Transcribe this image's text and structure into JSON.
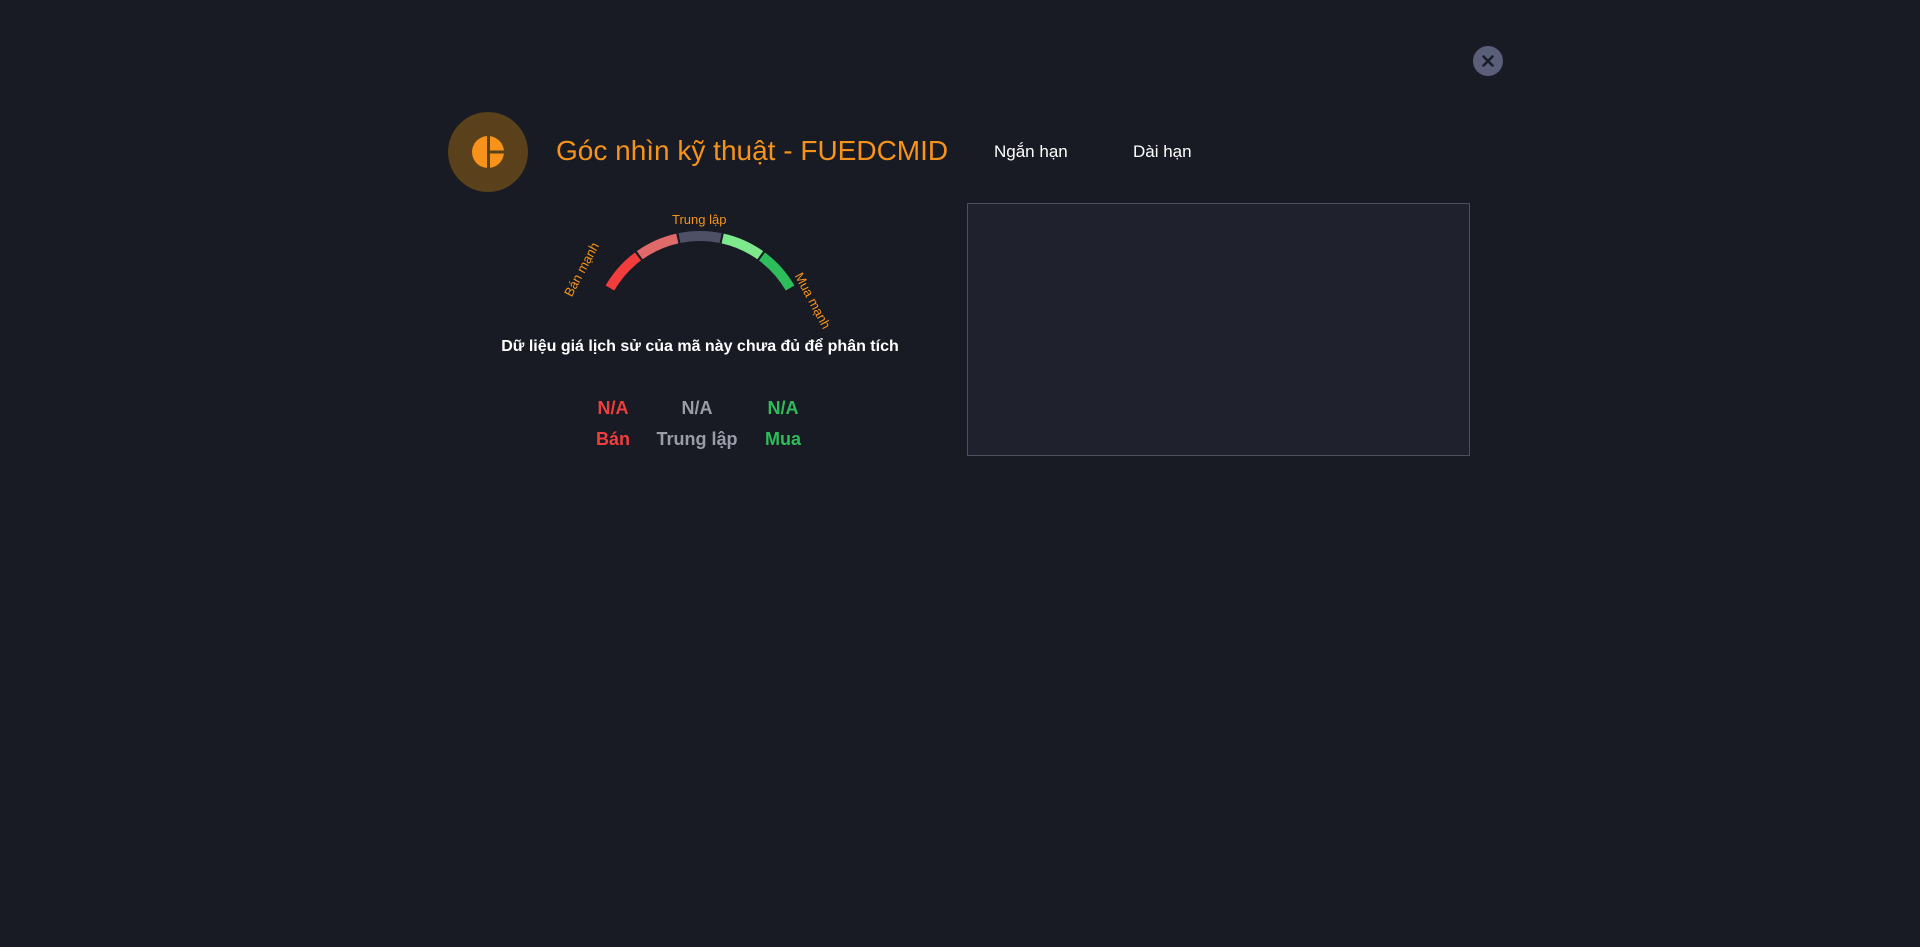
{
  "dialog": {
    "title": "Góc nhìn kỹ thuật - FUEDCMID",
    "close_icon": "close-icon",
    "header_icon": "pie-chart-icon"
  },
  "tabs": [
    {
      "label": "Ngắn hạn"
    },
    {
      "label": "Dài hạn"
    }
  ],
  "gauge": {
    "labels": {
      "strong_sell": "Bán mạnh",
      "neutral": "Trung lập",
      "strong_buy": "Mua mạnh"
    },
    "segment_colors": [
      "#f23d3d",
      "#e06a6a",
      "#4e5066",
      "#7ee88c",
      "#2dbd5a"
    ]
  },
  "notice": "Dữ liệu giá lịch sử của mã này chưa đủ để phân tích",
  "summary": {
    "sell": {
      "value": "N/A",
      "label": "Bán",
      "color": "#f23d3d"
    },
    "neutral": {
      "value": "N/A",
      "label": "Trung lập",
      "color": "#9a9ca8"
    },
    "buy": {
      "value": "N/A",
      "label": "Mua",
      "color": "#2dbd5a"
    }
  },
  "colors": {
    "background": "#181b24",
    "accent": "#f7931a"
  }
}
